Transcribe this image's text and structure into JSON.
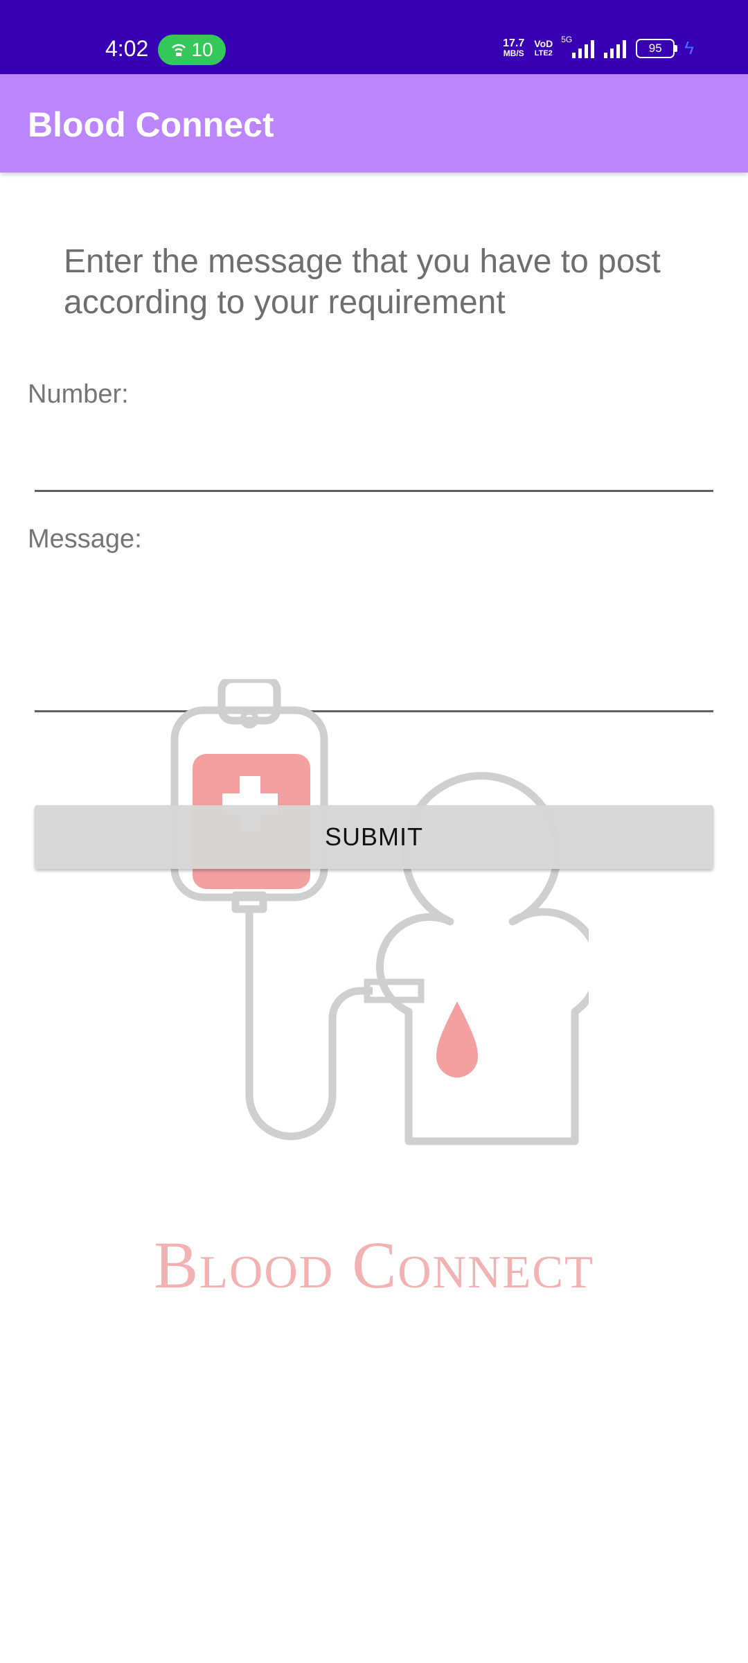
{
  "status_bar": {
    "time": "4:02",
    "hotspot_count": "10",
    "net_speed_value": "17.7",
    "net_speed_unit": "MB/S",
    "volte_top": "VoD",
    "volte_bottom": "LTE2",
    "network_type": "5G",
    "battery_level": "95",
    "icons": [
      "hotspot-icon",
      "signal-icon",
      "battery-icon",
      "charging-icon"
    ]
  },
  "app_bar": {
    "title": "Blood Connect"
  },
  "form": {
    "instruction": "Enter the message that you have to post according to your requirement",
    "number_label": "Number:",
    "number_value": "",
    "message_label": "Message:",
    "message_value": "",
    "submit_label": "SUBMIT"
  },
  "branding": {
    "logo_text": "Blood Connect"
  },
  "colors": {
    "status_bar": "#3700b3",
    "app_bar": "#bb86fc",
    "logo_gray": "#cfcfcf",
    "logo_red": "#f2a0a0"
  }
}
